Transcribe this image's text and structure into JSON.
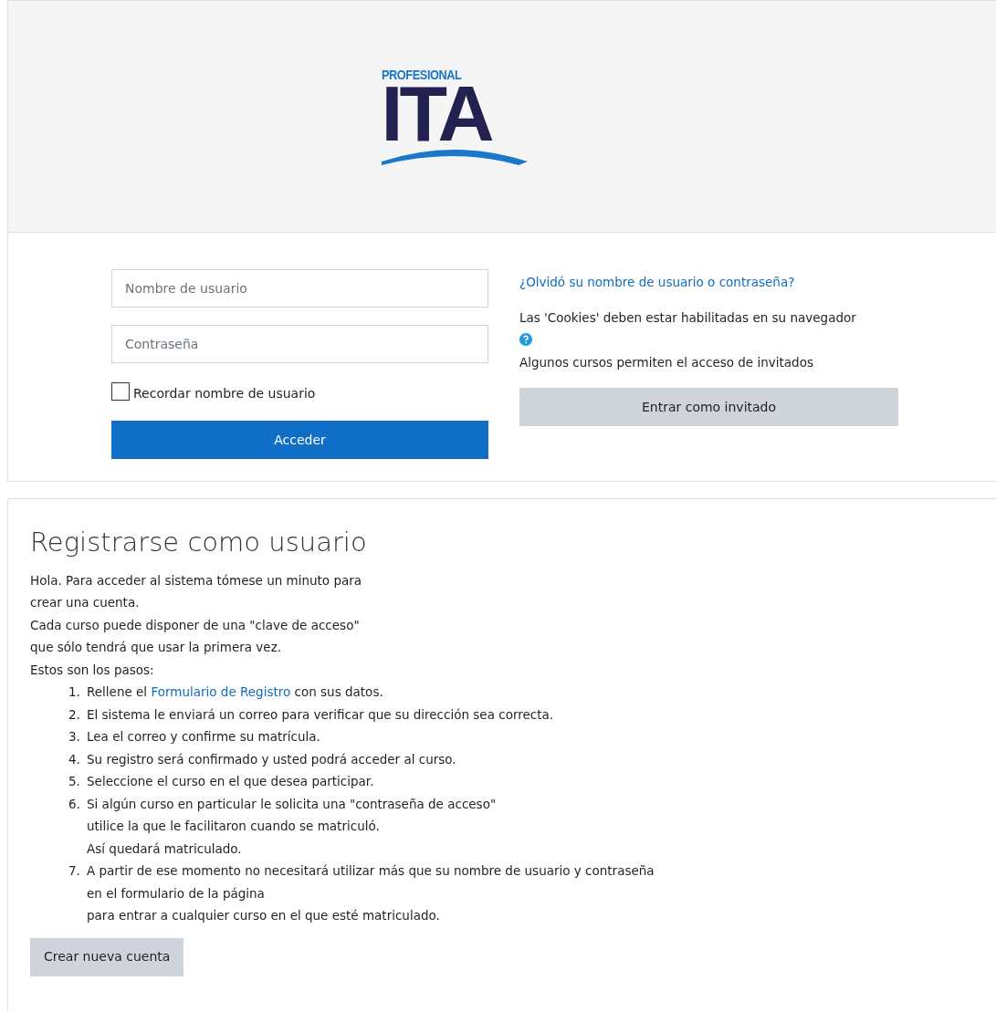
{
  "logo": {
    "caption": "PROFESIONAL",
    "mark": "ITA"
  },
  "login": {
    "username": {
      "placeholder": "Nombre de usuario"
    },
    "password": {
      "placeholder": "Contraseña"
    },
    "remember": {
      "label": "Recordar nombre de usuario",
      "checked": false
    },
    "submit": "Acceder"
  },
  "side": {
    "forgot_link": "¿Olvidó su nombre de usuario o contraseña?",
    "cookies_note": "Las 'Cookies' deben estar habilitadas en su navegador",
    "guest_note": "Algunos cursos permiten el acceso de invitados",
    "guest_button": "Entrar como invitado"
  },
  "signup": {
    "title": "Registrarse como usuario",
    "intro": [
      "Hola. Para acceder al sistema tómese un minuto para",
      "crear una cuenta.",
      "Cada curso puede disponer de una \"clave de acceso\"",
      "que sólo tendrá que usar la primera vez.",
      "Estos son los pasos:"
    ],
    "steps": [
      {
        "kind": "link",
        "marker": "1.",
        "before": "Rellene el ",
        "link": "Formulario de Registro",
        "after": " con sus datos."
      },
      {
        "kind": "text",
        "marker": "2.",
        "lines": [
          "El sistema le enviará un correo para verificar que su dirección sea correcta."
        ]
      },
      {
        "kind": "text",
        "marker": "3.",
        "lines": [
          "Lea el correo y confirme su matrícula."
        ]
      },
      {
        "kind": "text",
        "marker": "4.",
        "lines": [
          "Su registro será confirmado y usted podrá acceder al curso."
        ]
      },
      {
        "kind": "text",
        "marker": "5.",
        "lines": [
          "Seleccione el curso en el que desea participar."
        ]
      },
      {
        "kind": "text",
        "marker": "6.",
        "lines": [
          "Si algún curso en particular le solicita una \"contraseña de acceso\"",
          "utilice la que le facilitaron cuando se matriculó.",
          "Así quedará matriculado."
        ]
      },
      {
        "kind": "text",
        "marker": "7.",
        "lines": [
          "A partir de ese momento no necesitará utilizar más que su nombre de usuario y contraseña",
          "en el formulario de la página",
          "para entrar a cualquier curso en el que esté matriculado."
        ]
      }
    ],
    "button": "Crear nueva cuenta"
  }
}
